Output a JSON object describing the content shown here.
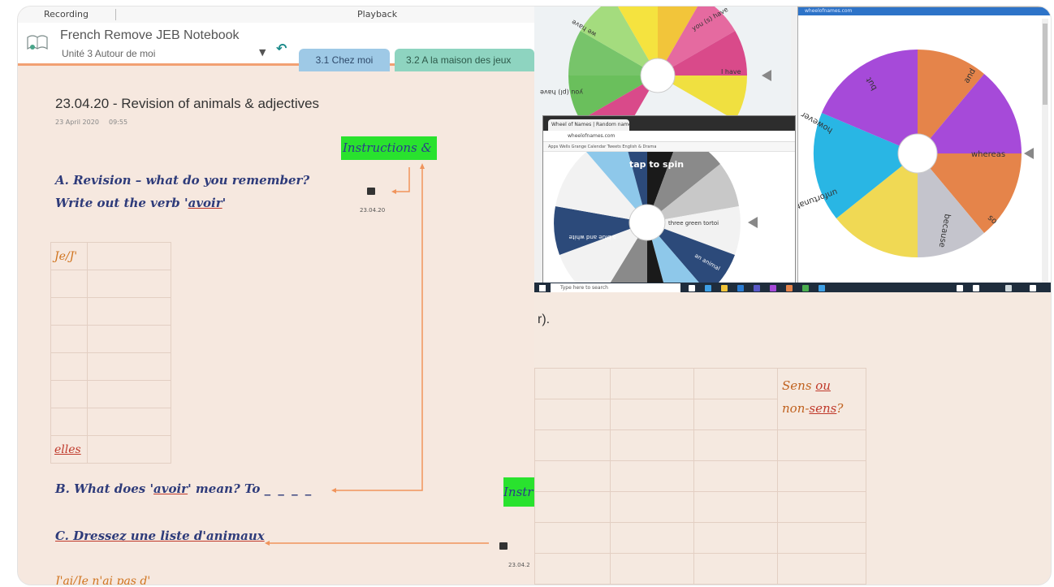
{
  "onenote": {
    "topbar": {
      "recording": "Recording",
      "playback": "Playback"
    },
    "notebook_title": "French Remove JEB Notebook",
    "section_group": "Unité 3 Autour de moi",
    "tabs": [
      "3.1 Chez moi",
      "3.2 A la maison des jeux"
    ],
    "page_title": "23.04.20 - Revision of animals & adjectives",
    "page_date": "23 April 2020",
    "page_time": "09:55",
    "instructions_label": "Instructions &",
    "instructions_label_2": "Instr",
    "audio_label": "23.04.20",
    "audio_label_2": "23.04.2",
    "question_a_line1": "A. Revision – what do you remember?",
    "question_a_line2_prefix": "Write out the verb '",
    "question_a_verb": "avoir",
    "question_a_line2_suffix": "'",
    "verb_table": {
      "first_row": "Je/J'",
      "last_row": "elles"
    },
    "question_b_prefix": "B. What does '",
    "question_b_verb": "avoir",
    "question_b_suffix": "' mean? To ",
    "question_b_blank": "_ _ _ _",
    "question_c": "C. Dressez une liste d'animaux",
    "bottom_line": "J'ai/Je n'ai pas d'"
  },
  "screenshots": {
    "wheel_a_labels": [
      "we have",
      "you (pl) have",
      "you (s) have",
      "I have"
    ],
    "browser_tab": "Wheel of Names | Random name picker",
    "browser_url": "wheelofnames.com",
    "bookmarks": "Apps  Wells Grange  Calendar  Tweets  English & Drama",
    "wheel_b_labels": [
      "a blue and white",
      "three green tortoi",
      "an animal"
    ],
    "spin_prompt": "tap to spin",
    "wheel_c_title": "wheelofnames.com",
    "wheel_c_labels": [
      "but",
      "and",
      "however",
      "whereas",
      "unfortunately",
      "because",
      "so"
    ],
    "taskbar_search": "Type here to search"
  },
  "right_page": {
    "fragment": "r).",
    "sens_line1_prefix": "Sens ",
    "sens_ou": "ou",
    "sens_line2_prefix": "non-",
    "sens_word": "sens",
    "sens_line2_suffix": "?"
  },
  "colors": {
    "page_bg": "#f6e8df",
    "instructions_green": "#29e22e",
    "handwriting_blue": "#2e3b7a",
    "annotation_red": "#c0392b",
    "arrow_orange": "#f0945c",
    "tab_blue": "#9ec9e6",
    "tab_teal": "#8ed4c0"
  }
}
